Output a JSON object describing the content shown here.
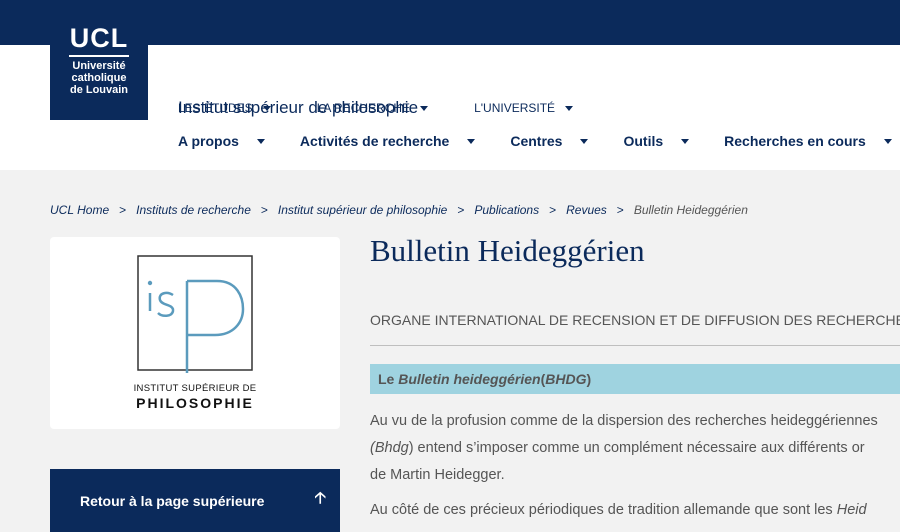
{
  "logo": {
    "abbr": "UCL",
    "line1": "Université",
    "line2": "catholique",
    "line3": "de Louvain"
  },
  "topnav": {
    "items": [
      {
        "label": "LES ÉTUDES"
      },
      {
        "label": "LA RECHERCHE"
      },
      {
        "label": "L'UNIVERSITÉ"
      }
    ]
  },
  "site_title": "Institut supérieur de philosophie",
  "mainnav": {
    "items": [
      {
        "label": "A propos"
      },
      {
        "label": "Activités de recherche"
      },
      {
        "label": "Centres"
      },
      {
        "label": "Outils"
      },
      {
        "label": "Recherches en cours"
      }
    ]
  },
  "breadcrumb": {
    "items": [
      {
        "label": "UCL Home"
      },
      {
        "label": "Instituts de recherche"
      },
      {
        "label": "Institut supérieur de philosophie"
      },
      {
        "label": "Publications"
      },
      {
        "label": "Revues"
      }
    ],
    "current": "Bulletin Heideggérien",
    "separator": ">"
  },
  "isp_logo": {
    "letters": "isP",
    "text_line1": "INSTITUT SUPÉRIEUR DE",
    "text_line2": "PHILOSOPHIE",
    "accent_color": "#5b9bbd"
  },
  "back_button": {
    "label": "Retour à la page supérieure",
    "icon": "arrow-up-icon"
  },
  "content": {
    "title": "Bulletin Heideggérien",
    "subtitle": "ORGANE INTERNATIONAL DE RECENSION ET DE DIFFUSION DES RECHERCHES",
    "callout": {
      "prefix": "Le ",
      "italic": "Bulletin heideggérien",
      "middle": " (",
      "abbr": "BHDG",
      "suffix": ")"
    },
    "para1": {
      "line1": "Au vu de la profusion comme de la dispersion des recherches heideggériennes",
      "line2_italic": "(Bhdg",
      "line2_rest": ") entend s’imposer comme un complément nécessaire aux différents or",
      "line3": "de Martin Heidegger."
    },
    "para2": {
      "line1": "Au côté de ces précieux périodiques de tradition allemande que sont les ",
      "line1_italic": "Heid"
    }
  },
  "colors": {
    "brand": "#0b2a5b",
    "callout_bg": "#9fd3e0",
    "page_bg": "#f2f2f2"
  }
}
